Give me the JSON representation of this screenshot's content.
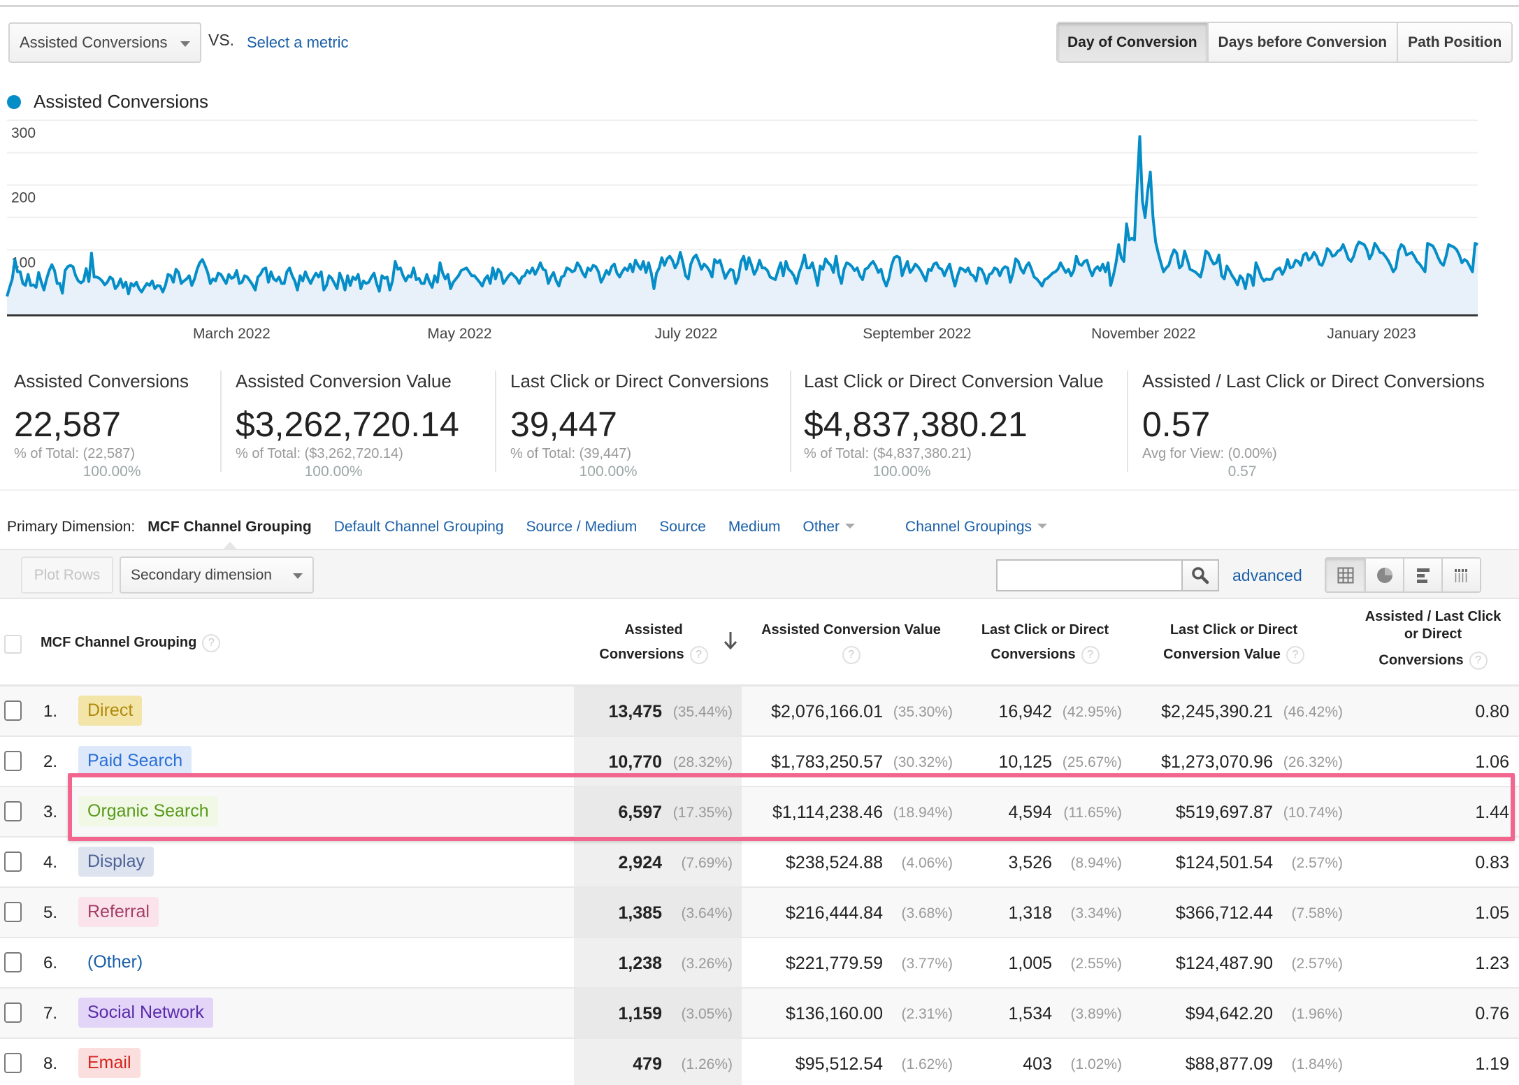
{
  "controls": {
    "metric_select": "Assisted Conversions",
    "vs_label": "VS.",
    "select_metric_link": "Select a metric",
    "tabs": [
      {
        "label": "Day of Conversion",
        "active": true
      },
      {
        "label": "Days before Conversion",
        "active": false
      },
      {
        "label": "Path Position",
        "active": false
      }
    ]
  },
  "legend": {
    "label": "Assisted Conversions",
    "color": "#058dc7"
  },
  "chart_data": {
    "type": "area",
    "title": "",
    "series": [
      {
        "name": "Assisted Conversions",
        "color": "#058dc7",
        "fill": "#e8f1f9"
      }
    ],
    "y_ticks": [
      "300",
      "200",
      "100"
    ],
    "ylim": [
      0,
      300
    ],
    "x_ticks": [
      "March 2022",
      "May 2022",
      "July 2022",
      "September 2022",
      "November 2022",
      "January 2023"
    ],
    "x_tick_positions": [
      0.148,
      0.303,
      0.457,
      0.614,
      0.768,
      0.923
    ],
    "grid": true,
    "legend": "top-left",
    "values": [
      28,
      42,
      55,
      85,
      66,
      66,
      48,
      45,
      62,
      45,
      46,
      42,
      65,
      50,
      38,
      55,
      68,
      77,
      68,
      48,
      48,
      33,
      68,
      74,
      76,
      74,
      60,
      52,
      49,
      52,
      71,
      51,
      95,
      58,
      58,
      56,
      52,
      46,
      50,
      58,
      55,
      40,
      45,
      55,
      42,
      50,
      32,
      48,
      44,
      50,
      40,
      35,
      42,
      48,
      45,
      52,
      40,
      45,
      44,
      35,
      45,
      62,
      60,
      50,
      70,
      65,
      48,
      52,
      55,
      60,
      45,
      55,
      70,
      80,
      85,
      76,
      65,
      48,
      55,
      52,
      64,
      62,
      55,
      48,
      62,
      56,
      58,
      68,
      48,
      50,
      60,
      58,
      52,
      46,
      38,
      58,
      62,
      70,
      72,
      50,
      66,
      55,
      52,
      58,
      48,
      48,
      66,
      72,
      60,
      52,
      38,
      60,
      52,
      66,
      56,
      48,
      57,
      64,
      58,
      66,
      38,
      45,
      60,
      56,
      48,
      40,
      64,
      54,
      38,
      60,
      45,
      58,
      54,
      62,
      40,
      52,
      48,
      50,
      58,
      64,
      48,
      36,
      60,
      56,
      58,
      38,
      52,
      82,
      70,
      72,
      60,
      52,
      60,
      58,
      72,
      54,
      56,
      48,
      48,
      62,
      50,
      42,
      60,
      50,
      80,
      64,
      55,
      62,
      40,
      50,
      55,
      60,
      68,
      70,
      72,
      66,
      60,
      60,
      55,
      50,
      44,
      55,
      60,
      48,
      72,
      55,
      70,
      65,
      48,
      54,
      60,
      64,
      60,
      56,
      48,
      58,
      60,
      68,
      64,
      72,
      62,
      70,
      80,
      70,
      68,
      48,
      58,
      65,
      52,
      44,
      58,
      60,
      72,
      70,
      66,
      68,
      80,
      74,
      64,
      58,
      72,
      68,
      76,
      74,
      66,
      50,
      58,
      68,
      62,
      74,
      78,
      64,
      58,
      66,
      72,
      68,
      78,
      66,
      84,
      76,
      70,
      82,
      65,
      80,
      64,
      40,
      64,
      72,
      88,
      76,
      86,
      90,
      84,
      72,
      80,
      96,
      80,
      60,
      55,
      78,
      88,
      92,
      82,
      70,
      78,
      74,
      68,
      58,
      85,
      80,
      84,
      70,
      56,
      64,
      70,
      68,
      48,
      58,
      82,
      90,
      70,
      88,
      76,
      62,
      70,
      84,
      72,
      72,
      68,
      58,
      56,
      54,
      68,
      80,
      60,
      82,
      70,
      66,
      60,
      48,
      65,
      76,
      92,
      72,
      72,
      80,
      64,
      45,
      75,
      70,
      86,
      80,
      76,
      65,
      90,
      62,
      48,
      70,
      80,
      78,
      74,
      68,
      72,
      60,
      54,
      70,
      72,
      78,
      82,
      75,
      65,
      70,
      54,
      44,
      56,
      76,
      88,
      90,
      88,
      60,
      72,
      82,
      65,
      70,
      78,
      74,
      68,
      60,
      52,
      70,
      68,
      78,
      80,
      72,
      70,
      60,
      70,
      78,
      60,
      44,
      60,
      72,
      70,
      66,
      72,
      62,
      60,
      52,
      72,
      70,
      62,
      48,
      62,
      64,
      72,
      70,
      60,
      70,
      74,
      72,
      50,
      64,
      86,
      82,
      70,
      64,
      75,
      80,
      70,
      58,
      55,
      50,
      44,
      54,
      56,
      60,
      64,
      66,
      70,
      80,
      72,
      65,
      70,
      60,
      68,
      90,
      78,
      76,
      82,
      84,
      70,
      60,
      70,
      74,
      68,
      78,
      66,
      80,
      45,
      60,
      80,
      108,
      88,
      82,
      140,
      115,
      118,
      115,
      200,
      275,
      175,
      150,
      190,
      220,
      150,
      112,
      95,
      80,
      66,
      72,
      76,
      90,
      100,
      95,
      72,
      76,
      98,
      85,
      70,
      68,
      66,
      62,
      58,
      75,
      98,
      95,
      85,
      78,
      80,
      92,
      60,
      55,
      75,
      68,
      60,
      54,
      46,
      60,
      55,
      40,
      62,
      60,
      45,
      80,
      70,
      58,
      52,
      55,
      54,
      55,
      66,
      70,
      72,
      62,
      70,
      85,
      72,
      74,
      84,
      82,
      76,
      92,
      95,
      84,
      88,
      96,
      90,
      78,
      76,
      86,
      102,
      98,
      90,
      92,
      98,
      100,
      108,
      98,
      86,
      82,
      90,
      104,
      112,
      110,
      108,
      100,
      86,
      94,
      110,
      104,
      96,
      95,
      90,
      84,
      76,
      66,
      72,
      98,
      108,
      105,
      92,
      94,
      96,
      90,
      82,
      78,
      72,
      66,
      110,
      108,
      106,
      98,
      88,
      80,
      76,
      90,
      108,
      106,
      104,
      100,
      92,
      80,
      85,
      82,
      74,
      66,
      110,
      108
    ]
  },
  "summary": [
    {
      "title": "Assisted Conversions",
      "value": "22,587",
      "sub_label": "% of Total:",
      "sub_pct": "100.00%",
      "sub_detail": "(22,587)"
    },
    {
      "title": "Assisted Conversion Value",
      "value": "$3,262,720.14",
      "sub_label": "% of Total:",
      "sub_pct": "100.00%",
      "sub_detail": "($3,262,720.14)"
    },
    {
      "title": "Last Click or Direct Conversions",
      "value": "39,447",
      "sub_label": "% of Total:",
      "sub_pct": "100.00%",
      "sub_detail": "(39,447)"
    },
    {
      "title": "Last Click or Direct Conversion Value",
      "value": "$4,837,380.21",
      "sub_label": "% of Total:",
      "sub_pct": "100.00%",
      "sub_detail": "($4,837,380.21)"
    },
    {
      "title": "Assisted / Last Click or Direct Conversions",
      "value": "0.57",
      "sub_label": "Avg for View:",
      "sub_pct": "0.57",
      "sub_detail": "(0.00%)"
    }
  ],
  "dimensions": {
    "label": "Primary Dimension:",
    "active": "MCF Channel Grouping",
    "links": [
      "Default Channel Grouping",
      "Source / Medium",
      "Source",
      "Medium"
    ],
    "dropdowns": [
      "Other",
      "Channel Groupings"
    ]
  },
  "toolbar": {
    "plot_rows": "Plot Rows",
    "secondary_dimension": "Secondary dimension",
    "search_value": "",
    "advanced": "advanced"
  },
  "table": {
    "headers": {
      "dimension": "MCF Channel Grouping",
      "assisted_conv": [
        "Assisted",
        "Conversions"
      ],
      "assisted_value": "Assisted Conversion Value",
      "last_click_conv": [
        "Last Click or Direct",
        "Conversions"
      ],
      "last_click_value": [
        "Last Click or Direct",
        "Conversion Value"
      ],
      "ratio": [
        "Assisted / Last Click",
        "or Direct",
        "Conversions"
      ],
      "help": "?"
    },
    "rows": [
      {
        "idx": "1.",
        "channel": "Direct",
        "chip_bg": "#f3e4a8",
        "chip_fg": "#b08a0a",
        "ac": "13,475",
        "ac_pct": "(35.44%)",
        "av": "$2,076,166.01",
        "av_pct": "(35.30%)",
        "lc": "16,942",
        "lc_pct": "(42.95%)",
        "lv": "$2,245,390.21",
        "lv_pct": "(46.42%)",
        "ratio": "0.80"
      },
      {
        "idx": "2.",
        "channel": "Paid Search",
        "chip_bg": "#dde9fb",
        "chip_fg": "#2a6fd6",
        "ac": "10,770",
        "ac_pct": "(28.32%)",
        "av": "$1,783,250.57",
        "av_pct": "(30.32%)",
        "lc": "10,125",
        "lc_pct": "(25.67%)",
        "lv": "$1,273,070.96",
        "lv_pct": "(26.32%)",
        "ratio": "1.06"
      },
      {
        "idx": "3.",
        "channel": "Organic Search",
        "chip_bg": "#f1f9e6",
        "chip_fg": "#5a9a1c",
        "ac": "6,597",
        "ac_pct": "(17.35%)",
        "av": "$1,114,238.46",
        "av_pct": "(18.94%)",
        "lc": "4,594",
        "lc_pct": "(11.65%)",
        "lv": "$519,697.87",
        "lv_pct": "(10.74%)",
        "ratio": "1.44"
      },
      {
        "idx": "4.",
        "channel": "Display",
        "chip_bg": "#dde3ef",
        "chip_fg": "#4f6296",
        "ac": "2,924",
        "ac_pct": "(7.69%)",
        "av": "$238,524.88",
        "av_pct": "(4.06%)",
        "lc": "3,526",
        "lc_pct": "(8.94%)",
        "lv": "$124,501.54",
        "lv_pct": "(2.57%)",
        "ratio": "0.83"
      },
      {
        "idx": "5.",
        "channel": "Referral",
        "chip_bg": "#fbe3ec",
        "chip_fg": "#a33e64",
        "ac": "1,385",
        "ac_pct": "(3.64%)",
        "av": "$216,444.84",
        "av_pct": "(3.68%)",
        "lc": "1,318",
        "lc_pct": "(3.34%)",
        "lv": "$366,712.44",
        "lv_pct": "(7.58%)",
        "ratio": "1.05"
      },
      {
        "idx": "6.",
        "channel": "(Other)",
        "chip_bg": "transparent",
        "chip_fg": "#1a5fa8",
        "ac": "1,238",
        "ac_pct": "(3.26%)",
        "av": "$221,779.59",
        "av_pct": "(3.77%)",
        "lc": "1,005",
        "lc_pct": "(2.55%)",
        "lv": "$124,487.90",
        "lv_pct": "(2.57%)",
        "ratio": "1.23"
      },
      {
        "idx": "7.",
        "channel": "Social Network",
        "chip_bg": "#e2d5f8",
        "chip_fg": "#5a2aa8",
        "ac": "1,159",
        "ac_pct": "(3.05%)",
        "av": "$136,160.00",
        "av_pct": "(2.31%)",
        "lc": "1,534",
        "lc_pct": "(3.89%)",
        "lv": "$94,642.20",
        "lv_pct": "(1.96%)",
        "ratio": "0.76"
      },
      {
        "idx": "8.",
        "channel": "Email",
        "chip_bg": "#fbdede",
        "chip_fg": "#d2261e",
        "ac": "479",
        "ac_pct": "(1.26%)",
        "av": "$95,512.54",
        "av_pct": "(1.62%)",
        "lc": "403",
        "lc_pct": "(1.02%)",
        "lv": "$88,877.09",
        "lv_pct": "(1.84%)",
        "ratio": "1.19"
      }
    ],
    "highlighted_row": 2,
    "highlight_color": "#f2658f"
  }
}
